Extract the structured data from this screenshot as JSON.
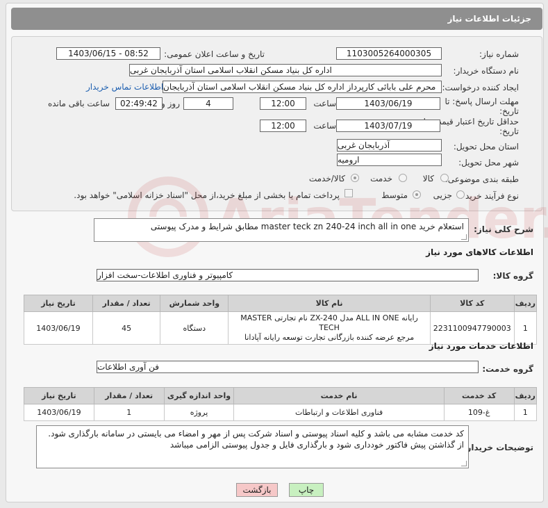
{
  "header": {
    "title": "جزئیات اطلاعات نیاز"
  },
  "fields": {
    "need_number_label": "شماره نیاز:",
    "need_number": "1103005264000305",
    "announce_label": "تاریخ و ساعت اعلان عمومی:",
    "announce_value": "1403/06/15 - 08:52",
    "buyer_org_label": "نام دستگاه خریدار:",
    "buyer_org": "اداره کل بنیاد مسکن انقلاب اسلامی استان آذربایجان غربی",
    "creator_label": "ایجاد کننده درخواست:",
    "creator": "محرم علی بابائی کارپرداز اداره کل بنیاد مسکن انقلاب اسلامی استان آذربایجان",
    "contact_link": "اطلاعات تماس خریدار",
    "deadline_label_1": "مهلت ارسال پاسخ: تا",
    "deadline_label_2": "تاریخ:",
    "deadline_date": "1403/06/19",
    "time_label": "ساعت",
    "deadline_time": "12:00",
    "days_value": "4",
    "days_label": "روز و",
    "remaining_time": "02:49:42",
    "remaining_label": "ساعت باقی مانده",
    "validity_label_1": "حداقل تاریخ اعتبار قیمت: تا",
    "validity_label_2": "تاریخ:",
    "validity_date": "1403/07/19",
    "validity_time": "12:00",
    "province_label": "استان محل تحویل:",
    "province": "آذربایجان غربی",
    "city_label": "شهر محل تحویل:",
    "city": "ارومیه",
    "category_label": "طبقه بندی موضوعی:",
    "category_options": [
      "کالا",
      "خدمت",
      "کالا/خدمت"
    ],
    "purchase_type_label": "نوع فرآیند خرید :",
    "purchase_options": [
      "جزیی",
      "متوسط"
    ],
    "payment_note": "پرداخت تمام یا بخشی از مبلغ خرید،از محل \"اسناد خزانه اسلامی\" خواهد بود."
  },
  "description": {
    "label": "شرح کلی نیاز:",
    "value": "استعلام خرید master teck zn 240-24 inch all in one مطابق شرایط و مدرک پیوستی"
  },
  "goods": {
    "section_title": "اطلاعات کالاهای مورد نیاز",
    "group_label": "گروه کالا:",
    "group_value": "کامپیوتر و فناوری اطلاعات-سخت افزار",
    "columns": [
      "ردیف",
      "کد کالا",
      "نام کالا",
      "واحد شمارش",
      "تعداد / مقدار",
      "تاریخ نیاز"
    ],
    "rows": [
      {
        "row": "1",
        "code": "2231100947790003",
        "name_line1": "رایانه ALL IN ONE مدل ZX-240 نام تجارتی MASTER TECH",
        "name_line2": "مرجع عرضه کننده بازرگانی تجارت توسعه رایانه آپادانا",
        "unit": "دستگاه",
        "qty": "45",
        "date": "1403/06/19"
      }
    ]
  },
  "services": {
    "section_title": "اطلاعات خدمات مورد نیاز",
    "group_label": "گروه خدمت:",
    "group_value": "فن آوری اطلاعات",
    "columns": [
      "ردیف",
      "کد خدمت",
      "نام خدمت",
      "واحد اندازه گیری",
      "تعداد / مقدار",
      "تاریخ نیاز"
    ],
    "rows": [
      {
        "row": "1",
        "code": "غ-109",
        "name": "فناوری اطلاعات و ارتباطات",
        "unit": "پروژه",
        "qty": "1",
        "date": "1403/06/19"
      }
    ]
  },
  "buyer_notes": {
    "label": "توضیحات خریدار:",
    "line1": "کد خدمت مشابه می باشد و کلیه اسناد پیوستی و اسناد شرکت پس از مهر و امضاء می بایستی در سامانه بارگذاری شود.",
    "line2": "از گذاشتن پیش فاکتور خودداری شود و بارگذاری فایل و جدول پیوستی الزامی میباشد"
  },
  "buttons": {
    "print": "چاپ",
    "back": "بازگشت"
  },
  "colors": {
    "print_bg": "#c8f0c0",
    "back_bg": "#f6c8c8",
    "header_bg": "#8f8f8f",
    "link": "#1d5fb0"
  }
}
